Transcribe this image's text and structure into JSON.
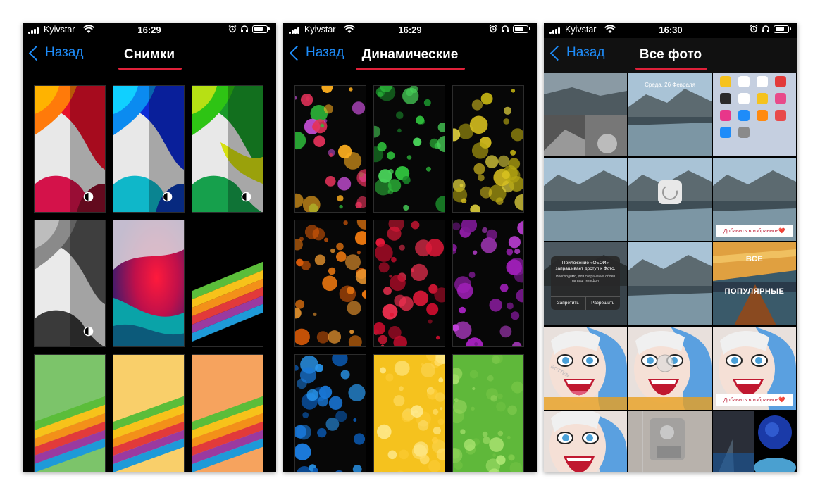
{
  "panels": [
    {
      "carrier": "Kyivstar",
      "time": "16:29",
      "back_label": "Назад",
      "title": "Снимки"
    },
    {
      "carrier": "Kyivstar",
      "time": "16:29",
      "back_label": "Назад",
      "title": "Динамические"
    },
    {
      "carrier": "Kyivstar",
      "time": "16:30",
      "back_label": "Назад",
      "title": "Все фото"
    }
  ],
  "photos": {
    "lock_date": "Среда, 26 Февраля",
    "favorite_label_1": "Добавить в избранное❤️",
    "favorite_label_2": "Добавить в избранное❤️",
    "alert_title": "Приложение «ОБОИ» запрашивает доступ к Фото.",
    "alert_body": "Необходимо, для сохранения обоев на ваш телефон",
    "alert_deny": "Запретить",
    "alert_allow": "Разрешить",
    "category_all": "ВСЕ",
    "category_popular": "ПОПУЛЯРНЫЕ",
    "watermark": "ROTTEN"
  },
  "colors": {
    "accent": "#1e8cf9",
    "underline": "#e0213a",
    "background": "#000000"
  }
}
